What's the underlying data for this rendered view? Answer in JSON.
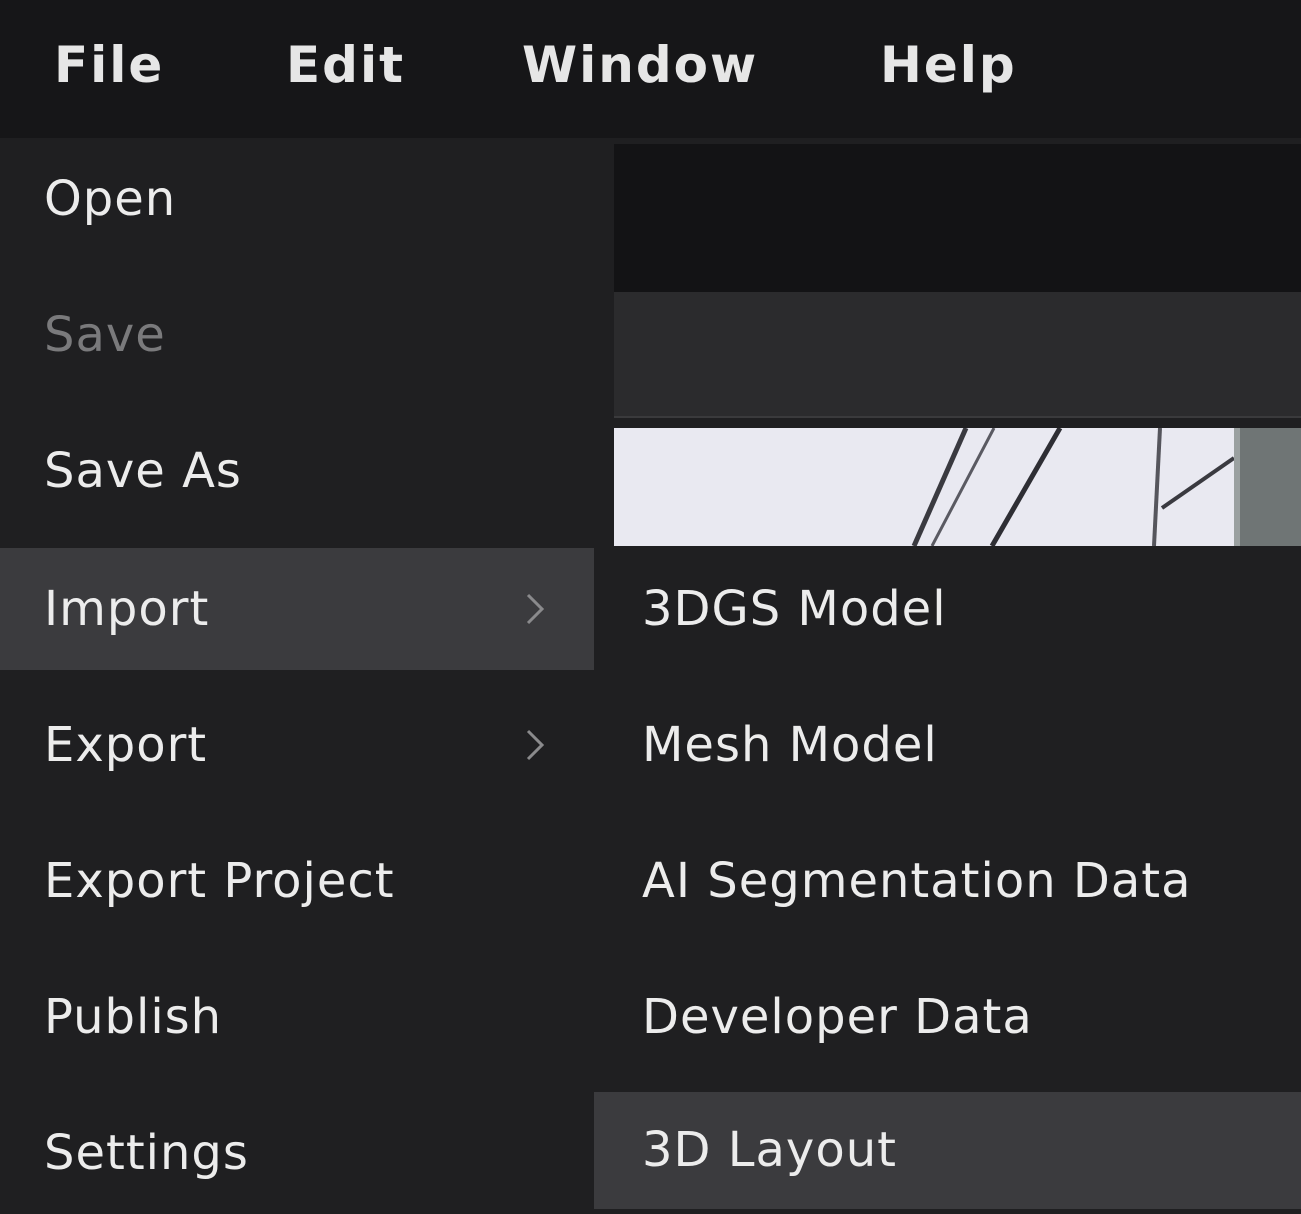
{
  "menubar": {
    "items": [
      {
        "label": "File"
      },
      {
        "label": "Edit"
      },
      {
        "label": "Window"
      },
      {
        "label": "Help"
      }
    ]
  },
  "file_menu": {
    "items": [
      {
        "label": "Open",
        "enabled": true
      },
      {
        "label": "Save",
        "enabled": false
      },
      {
        "label": "Save As",
        "enabled": true
      },
      {
        "label": "Import",
        "enabled": true,
        "submenu": true,
        "highlighted": true
      },
      {
        "label": "Export",
        "enabled": true,
        "submenu": true
      },
      {
        "label": "Export Project",
        "enabled": true
      },
      {
        "label": "Publish",
        "enabled": true
      },
      {
        "label": "Settings",
        "enabled": true
      }
    ]
  },
  "import_submenu": {
    "items": [
      {
        "label": "3DGS Model"
      },
      {
        "label": "Mesh Model"
      },
      {
        "label": "AI Segmentation Data"
      },
      {
        "label": "Developer Data"
      },
      {
        "label": "3D Layout",
        "highlighted": true
      }
    ]
  },
  "colors": {
    "menubar_bg": "#161618",
    "menu_bg": "#1f1f21",
    "highlight_bg": "#3b3b3e",
    "text": "#ececec",
    "disabled_text": "#7a7a7c"
  }
}
